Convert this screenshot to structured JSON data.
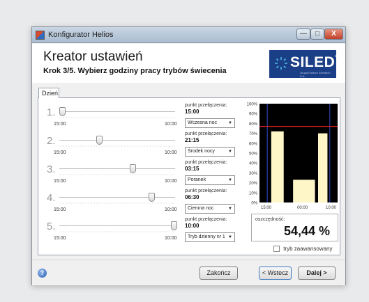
{
  "window": {
    "title": "Konfigurator Helios",
    "min": "—",
    "max": "□",
    "close": "X"
  },
  "header": {
    "title": "Kreator ustawień",
    "subtitle": "Krok 3/5. Wybierz godziny pracy trybów świecenia"
  },
  "logo": {
    "text": "SILED",
    "mark": "°",
    "tagline": "Grupa Fantom Servitech S.A."
  },
  "tab": "Dzień",
  "rows": [
    {
      "num": "1.",
      "left": "15:00",
      "right": "10:00",
      "pp_label": "punkt przełączenia:",
      "time": "15:00",
      "mode": "Wczesna noc",
      "thumb": 0.0
    },
    {
      "num": "2.",
      "left": "15:00",
      "right": "10:00",
      "pp_label": "punkt przełączenia:",
      "time": "21:15",
      "mode": "Środek nocy",
      "thumb": 0.33
    },
    {
      "num": "3.",
      "left": "15:00",
      "right": "10:00",
      "pp_label": "punkt przełączenia:",
      "time": "03:15",
      "mode": "Poranek",
      "thumb": 0.63
    },
    {
      "num": "4.",
      "left": "15:00",
      "right": "10:00",
      "pp_label": "punkt przełączenia:",
      "time": "06:30",
      "mode": "Ciemna noc",
      "thumb": 0.8
    },
    {
      "num": "5.",
      "left": "15:00",
      "right": "10:00",
      "pp_label": "punkt przełączenia:",
      "time": "10:00",
      "mode": "Tryb dzienny nr 1",
      "thumb": 1.0
    }
  ],
  "chart_data": {
    "type": "bar",
    "yticks": [
      "100%",
      "90%",
      "80%",
      "70%",
      "60%",
      "50%",
      "40%",
      "30%",
      "20%",
      "10%",
      "0%"
    ],
    "xticks": [
      "15:00",
      "00:00",
      "10:00"
    ],
    "ylim": [
      0,
      100
    ],
    "bars": [
      {
        "start": 0.15,
        "end": 0.31,
        "value": 72
      },
      {
        "start": 0.43,
        "end": 0.71,
        "value": 23
      },
      {
        "start": 0.75,
        "end": 0.87,
        "value": 70
      }
    ],
    "threshold": 77,
    "colors": {
      "bg": "#000000",
      "bar": "#fff6c8",
      "line": "#e52020",
      "divider": "#2a3fb0"
    }
  },
  "efficiency": {
    "label": "oszczędność:",
    "value": "54,44 %"
  },
  "advanced": {
    "label": "tryb zaawansowany",
    "checked": false
  },
  "footer": {
    "help": "?",
    "finish": "Zakończ",
    "back": "< Wstecz",
    "next": "Dalej >"
  }
}
